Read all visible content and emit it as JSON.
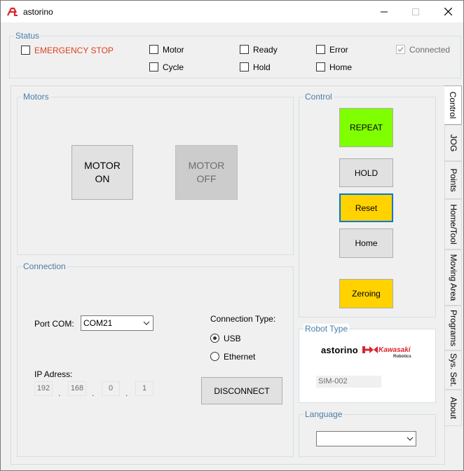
{
  "app": {
    "title": "astorino"
  },
  "status": {
    "title": "Status",
    "items": {
      "emergency_stop": "EMERGENCY STOP",
      "motor": "Motor",
      "ready": "Ready",
      "error": "Error",
      "connected": "Connected",
      "cycle": "Cycle",
      "hold": "Hold",
      "home": "Home"
    },
    "emergency_color": "#e0401e"
  },
  "motors": {
    "title": "Motors",
    "motor_on_line1": "MOTOR",
    "motor_on_line2": "ON",
    "motor_off_line1": "MOTOR",
    "motor_off_line2": "OFF"
  },
  "connection": {
    "title": "Connection",
    "port_label": "Port COM:",
    "port_value": "COM21",
    "connection_type_label": "Connection Type:",
    "usb_label": "USB",
    "ethernet_label": "Ethernet",
    "ip_label": "IP Adress:",
    "ip": [
      "192",
      "168",
      "0",
      "1"
    ],
    "disconnect_label": "DISCONNECT",
    "selected_type": "USB"
  },
  "control": {
    "title": "Control",
    "repeat_label": "REPEAT",
    "hold_label": "HOLD",
    "reset_label": "Reset",
    "home_label": "Home",
    "zeroing_label": "Zeroing",
    "repeat_color": "#80ff00",
    "reset_color": "#ffd200",
    "zeroing_color": "#ffd200"
  },
  "robot_type": {
    "title": "Robot Type",
    "brand": "astorino",
    "kawasaki": "Kawasaki",
    "robotics": "Robotics",
    "model": "SIM-002"
  },
  "language": {
    "title": "Language",
    "value": ""
  },
  "tabs": [
    {
      "label": "Control",
      "active": true
    },
    {
      "label": "JOG",
      "active": false
    },
    {
      "label": "Points",
      "active": false
    },
    {
      "label": "Home/Tool",
      "active": false
    },
    {
      "label": "Moving Area",
      "active": false
    },
    {
      "label": "Programs",
      "active": false
    },
    {
      "label": "Sys. Set.",
      "active": false
    },
    {
      "label": "About",
      "active": false
    }
  ]
}
